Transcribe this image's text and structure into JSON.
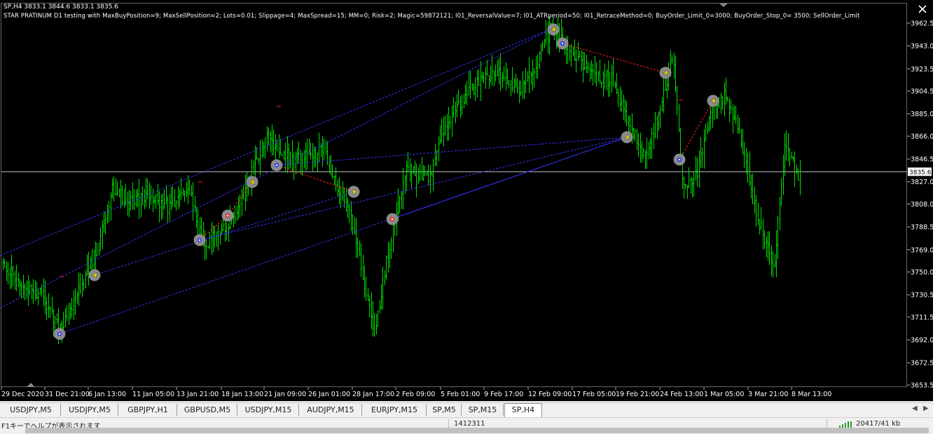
{
  "chart": {
    "ohlc_line": "SP,H4  3833.1 3844.6 3833.1 3835.6",
    "ea_line": "STAR PRATINUM D1 testing with MaxBuyPosition=9; MaxSellPosition=2; Lots=0.01; Slippage=4; MaxSpread=15; MM=0; Risk=2; Magic=59872121; I01_ReversalValue=7; I01_ATRperiod=50; I01_RetraceMethod=0; BuyOrder_Limit_0=3000; BuyOrder_Stop_0= 3500; SellOrder_Limit",
    "current_price_label": "3835.6",
    "price_ticks": [
      "3962.5",
      "3943.0",
      "3923.5",
      "3904.5",
      "3885.0",
      "3866.0",
      "3846.5",
      "3827.0",
      "3808.0",
      "3788.5",
      "3769.0",
      "3750.0",
      "3730.5",
      "3711.5",
      "3692.0",
      "3672.5",
      "3653.5"
    ],
    "time_ticks": [
      "29 Dec 2020",
      "31 Dec 21:00",
      "6 Jan 13:00",
      "11 Jan 05:00",
      "13 Jan 21:00",
      "18 Jan 13:00",
      "21 Jan 09:00",
      "26 Jan 01:00",
      "28 Jan 17:00",
      "2 Feb 09:00",
      "5 Feb 01:00",
      "9 Feb 17:00",
      "12 Feb 09:00",
      "17 Feb 05:00",
      "19 Feb 21:00",
      "24 Feb 13:00",
      "1 Mar 05:00",
      "3 Mar 21:00",
      "8 Mar 13:00"
    ],
    "colors": {
      "background": "#000000",
      "bars": "#00e000",
      "text": "#ffffff",
      "trend": "#3333ff",
      "trade_link": "#ff2020",
      "marker": "#8a8a8a"
    }
  },
  "tabs": [
    "USDJPY,M5",
    "USDJPY,M5",
    "GBPJPY,H1",
    "GBPUSD,M5",
    "USDJPY,M15",
    "AUDJPY,M15",
    "EURJPY,M15",
    "SP,M5",
    "SP,M15",
    "SP,H4"
  ],
  "active_tab": "SP,H4",
  "status": {
    "help_text": "F1キーでヘルプが表示されます",
    "counter": "1412311",
    "traffic": "20417/41 kb"
  }
}
